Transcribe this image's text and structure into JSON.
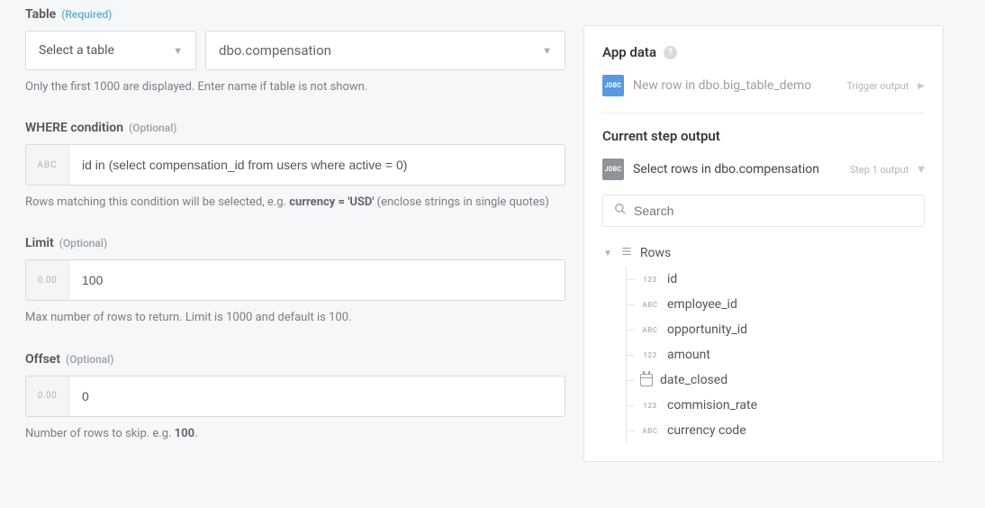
{
  "table": {
    "label": "Table",
    "req": "(Required)",
    "select_placeholder": "Select a table",
    "value": "dbo.compensation",
    "helper": "Only the first 1000 are displayed. Enter name if table is not shown."
  },
  "where": {
    "label": "WHERE condition",
    "opt": "(Optional)",
    "prefix": "ABC",
    "value": "id in (select compensation_id from users where active = 0)",
    "helper_pre": "Rows matching this condition will be selected, e.g. ",
    "helper_bold": "currency = 'USD'",
    "helper_post": " (enclose strings in single quotes)"
  },
  "limit": {
    "label": "Limit",
    "opt": "(Optional)",
    "prefix": "0.00",
    "value": "100",
    "helper": "Max number of rows to return. Limit is 1000 and default is 100."
  },
  "offset": {
    "label": "Offset",
    "opt": "(Optional)",
    "prefix": "0.00",
    "value": "0",
    "helper_pre": "Number of rows to skip. e.g. ",
    "helper_bold": "100",
    "helper_post": "."
  },
  "panel": {
    "app_data": "App data",
    "trigger_text": "New row in dbo.big_table_demo",
    "trigger_suffix": "Trigger output",
    "current": "Current step output",
    "step_text": "Select rows in dbo.compensation",
    "step_suffix": "Step 1 output",
    "search_placeholder": "Search",
    "rows_label": "Rows",
    "badge": "JDBC",
    "fields": [
      {
        "type": "123",
        "name": "id"
      },
      {
        "type": "ABC",
        "name": "employee_id"
      },
      {
        "type": "ABC",
        "name": "opportunity_id"
      },
      {
        "type": "123",
        "name": "amount"
      },
      {
        "type": "cal",
        "name": "date_closed"
      },
      {
        "type": "123",
        "name": "commision_rate"
      },
      {
        "type": "ABC",
        "name": "currency code"
      }
    ]
  }
}
